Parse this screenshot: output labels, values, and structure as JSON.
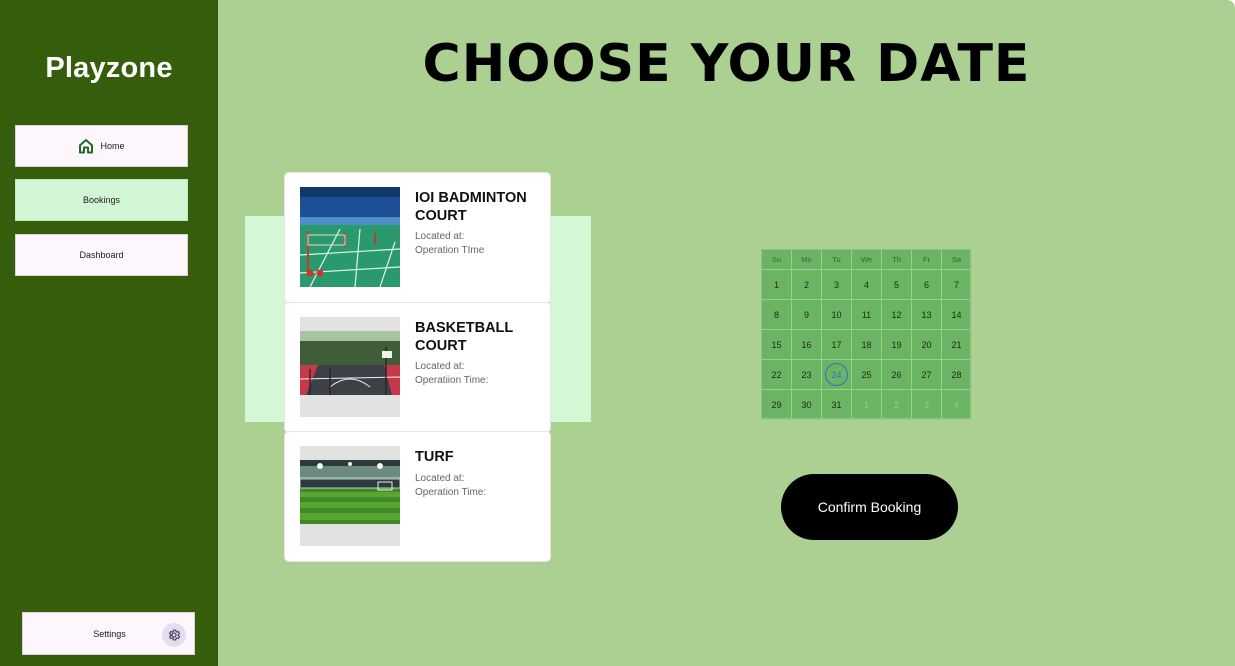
{
  "sidebar": {
    "brand": "Playzone",
    "nav": [
      {
        "label": "Home",
        "icon": "home-icon"
      },
      {
        "label": "Bookings"
      },
      {
        "label": "Dashboard"
      }
    ],
    "settings": {
      "label": "Settings",
      "icon": "gear-icon"
    }
  },
  "main": {
    "title": "CHOOSE YOUR DATE",
    "venues": [
      {
        "name": "IOI BADMINTON COURT",
        "location": "Located at:",
        "hours": "Operation TIme"
      },
      {
        "name": "BASKETBALL COURT",
        "location": "Located at:",
        "hours": "Operatiion Time:"
      },
      {
        "name": "TURF",
        "location": "Located at:",
        "hours": "Operation Time:"
      }
    ],
    "calendar": {
      "weekdays": [
        "Su",
        "Mo",
        "Tu",
        "We",
        "Th",
        "Fr",
        "Sa"
      ],
      "weeks": [
        [
          "1",
          "2",
          "3",
          "4",
          "5",
          "6",
          "7"
        ],
        [
          "8",
          "9",
          "10",
          "11",
          "12",
          "13",
          "14"
        ],
        [
          "15",
          "16",
          "17",
          "18",
          "19",
          "20",
          "21"
        ],
        [
          "22",
          "23",
          "24",
          "25",
          "26",
          "27",
          "28"
        ],
        [
          "29",
          "30",
          "31",
          "1",
          "2",
          "3",
          "4"
        ]
      ],
      "selected": "24"
    },
    "confirm_label": "Confirm Booking"
  },
  "colors": {
    "sidebar_bg": "#355d0b",
    "main_bg": "#abd091",
    "active_nav": "#d2f6d3",
    "calendar_bg": "#6ab463",
    "selected_ring": "#2f6fd1",
    "button_bg": "#000000"
  }
}
